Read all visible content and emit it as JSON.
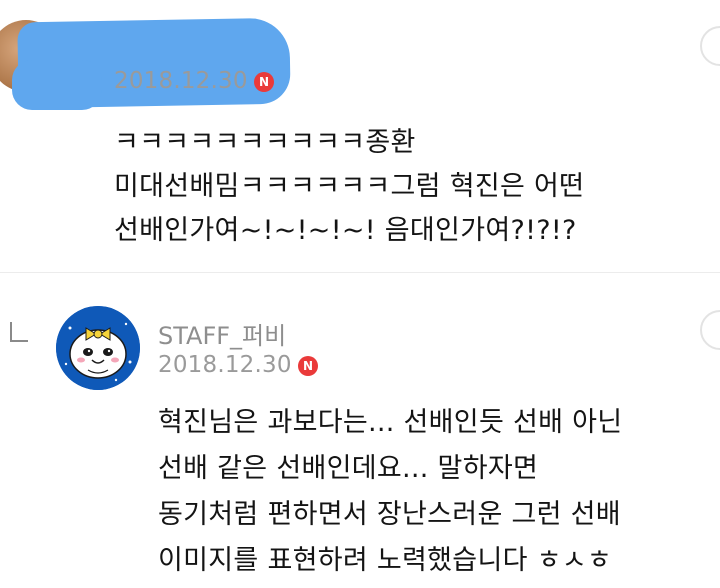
{
  "first_comment": {
    "date": "2018.12.30",
    "badge": "N",
    "lines": [
      "ㅋㅋㅋㅋㅋㅋㅋㅋㅋㅋ종환",
      "미대선배밈ㅋㅋㅋㅋㅋㅋ그럼 혁진은 어떤",
      "선배인가여~!~!~!~! 음대인가여?!?!?"
    ]
  },
  "reply": {
    "author": "STAFF_퍼비",
    "date": "2018.12.30",
    "badge": "N",
    "lines": [
      "혁진님은 과보다는... 선배인듯 선배 아닌",
      "선배 같은 선배인데요... 말하자면",
      "동기처럼 편하면서 장난스러운 그런 선배",
      "이미지를 표현하려 노력했습니다 ㅎㅅㅎ"
    ]
  },
  "colors": {
    "redaction": "#5fa7ee",
    "badge": "#ea3a3a",
    "staff_avatar_bg": "#0f59b8"
  }
}
